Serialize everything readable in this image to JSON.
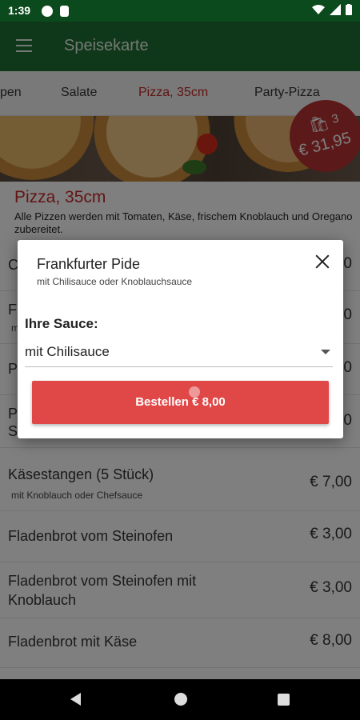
{
  "status_bar": {
    "time": "1:39"
  },
  "app_bar": {
    "title": "Speisekarte"
  },
  "tabs": [
    {
      "label": "pen"
    },
    {
      "label": "Salate"
    },
    {
      "label": "Pizza, 35cm"
    },
    {
      "label": "Party-Pizza"
    }
  ],
  "cart": {
    "count": "3",
    "total": "€ 31,95"
  },
  "section": {
    "title": "Pizza, 35cm",
    "description": "Alle Pizzen werden mit Tomaten, Käse, frischem Knoblauch und Oregano zubereitet."
  },
  "items": [
    {
      "name": "C",
      "price": "0"
    },
    {
      "name": "F",
      "price": "0",
      "sub": "m"
    },
    {
      "name": "P",
      "price": "0"
    },
    {
      "name": "P",
      "name2": "S",
      "price": "0"
    },
    {
      "name": "Käsestangen (5 Stück)",
      "sub": "mit Knoblauch oder Chefsauce",
      "price": "€ 7,00"
    },
    {
      "name": "Fladenbrot vom Steinofen",
      "price": "€ 3,00"
    },
    {
      "name": "Fladenbrot vom Steinofen mit Knoblauch",
      "price": "€ 3,00"
    },
    {
      "name": "Fladenbrot mit Käse",
      "price": "€ 8,00"
    }
  ],
  "dialog": {
    "title": "Frankfurter Pide",
    "subtitle": "mit Chilisauce oder Knoblauchsauce",
    "sauce_label": "Ihre Sauce:",
    "sauce_selected": "mit Chilisauce",
    "order_button": "Bestellen € 8,00"
  },
  "colors": {
    "appbar": "#1f6e32",
    "statusbar": "#0b4a1c",
    "accent_red": "#c62828",
    "button_red": "#e04848",
    "badge_red": "#b83232"
  }
}
